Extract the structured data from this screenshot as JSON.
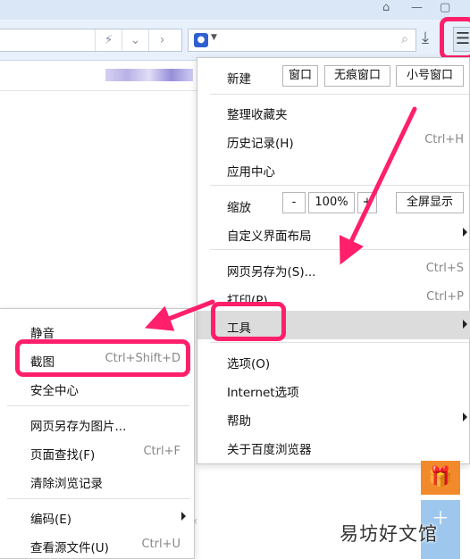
{
  "toolbar": {
    "lightning_icon": "⚡",
    "chevron_icon": "⌄",
    "forward_icon": "›",
    "search_engine_icon": "🐾",
    "search_icon": "⌕",
    "download_icon": "⤓",
    "menu_icon": "☰"
  },
  "main_menu": {
    "new_label": "新建",
    "new_window": "窗口",
    "new_incognito": "无痕窗口",
    "new_small": "小号窗口",
    "organize_favorites": "整理收藏夹",
    "history": "历史记录(H)",
    "history_shortcut": "Ctrl+H",
    "app_center": "应用中心",
    "zoom_label": "缩放",
    "zoom_minus": "-",
    "zoom_value": "100%",
    "zoom_plus": "+",
    "fullscreen": "全屏显示",
    "customize_ui": "自定义界面布局",
    "save_page_as": "网页另存为(S)...",
    "save_page_as_shortcut": "Ctrl+S",
    "print": "打印(P)...",
    "print_shortcut": "Ctrl+P",
    "tools": "工具",
    "options": "选项(O)",
    "internet_options": "Internet选项",
    "help": "帮助",
    "about": "关于百度浏览器"
  },
  "tools_submenu": {
    "mute": "静音",
    "screenshot": "截图",
    "screenshot_shortcut": "Ctrl+Shift+D",
    "security_center": "安全中心",
    "save_as_image": "网页另存为图片...",
    "find_in_page": "页面查找(F)",
    "find_in_page_shortcut": "Ctrl+F",
    "clear_history": "清除浏览记录",
    "encoding": "编码(E)",
    "view_source": "查看源文件(U)",
    "view_source_shortcut": "Ctrl+U"
  },
  "watermark": "易坊好文馆",
  "colors": {
    "highlight": "#ff1f6a",
    "menu_selected": "#dcdcdc",
    "toolbar_bg": "#e8f1fb"
  }
}
